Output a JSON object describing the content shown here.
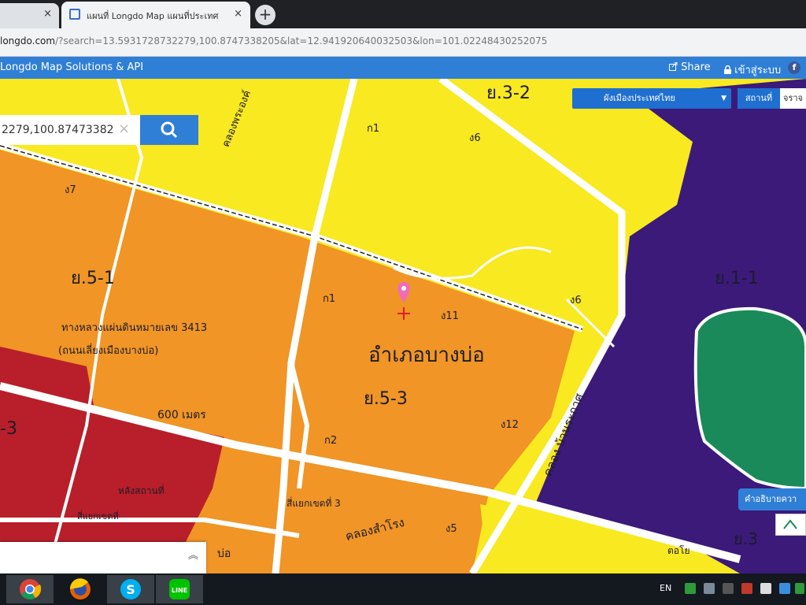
{
  "browser": {
    "prev_tab_close": "×",
    "active_tab_title": "แผนที่ Longdo Map แผนที่ประเทศ",
    "active_tab_close": "×",
    "new_tab": "+",
    "url_host": "longdo.com",
    "url_rest": "/?search=13.5931728732279,100.8747338205&lat=12.941920640032503&lon=101.02248430252075"
  },
  "site": {
    "brand": "Longdo Map Solutions & API",
    "share": "Share",
    "login": "เข้าสู่ระบบ",
    "facebook": "f"
  },
  "search": {
    "value": "2279,100.87473382",
    "clear": "×"
  },
  "layers": {
    "selected": "ผังเมืองประเทศไทย",
    "station_label": "สถานที่",
    "station_value": "จราจ"
  },
  "legend_button": "คำอธิบายควา",
  "bottom_panel_toggle": "︽",
  "map_labels": {
    "zone_y3_2": "ย.3-2",
    "zone_y5_1": "ย.5-1",
    "zone_y5_3": "ย.5-3",
    "zone_y1_1": "ย.1-1",
    "zone_left_3": "-3",
    "zone_y3_right": "ย.3",
    "district": "อำเภอบางบ่อ",
    "road_desc_1": "ทางหลวงแผ่นดินหมายเลข 3413",
    "road_desc_2": "(ถนนเลี่ยงเมืองบางบ่อ)",
    "distance": "600 เมตร",
    "canal_banprakot": "คลอง บ้านระกาศ",
    "canal_samrong": "คลองสำโรง",
    "canal_top": "คลองพระองค์",
    "junction_3": "สี่แยกเขตที่ 3",
    "intersection": "สี่แยกเขตที่",
    "road_left_1": "หลังสถานที่",
    "codes": {
      "c_v7": "ง7",
      "c_a1_top": "ก1",
      "c_v6": "ง6",
      "c_a1_mid": "ก1",
      "c_v11": "ง11",
      "c_a2": "ก2",
      "c_v12": "ง12",
      "c_v5": "ง5",
      "c_v6_right": "ง6"
    },
    "bottom_left": "บ่อ",
    "bottom_right": "ตอโย"
  },
  "taskbar": {
    "lang": "EN",
    "apps": [
      "chrome-icon",
      "firefox-icon",
      "skype-icon",
      "line-icon"
    ]
  },
  "colors": {
    "zone_yellow": "#f8e920",
    "zone_orange": "#f09526",
    "zone_red": "#b81f2a",
    "zone_purple": "#3b1a7a",
    "zone_green": "#1a8a5a",
    "accent_blue": "#2f7fd6",
    "marker_pink": "#f06bb8"
  }
}
